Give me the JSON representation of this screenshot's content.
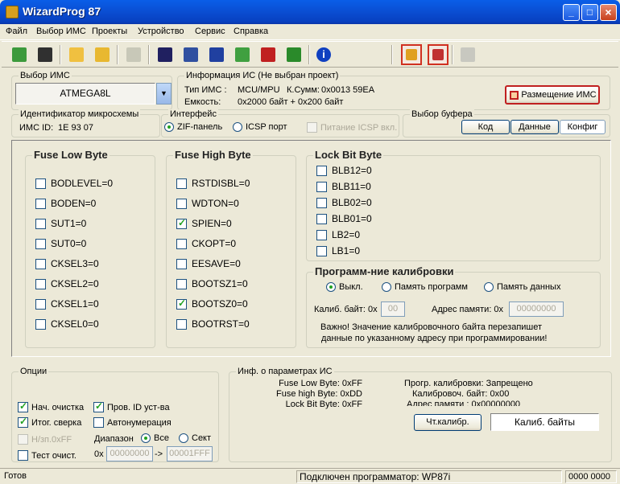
{
  "window": {
    "title": "WizardProg 87"
  },
  "menu": [
    "Файл",
    "Выбор ИМС",
    "Проекты",
    "Устройство",
    "Сервис",
    "Справка"
  ],
  "toolbar": {
    "icons": [
      "open-icon",
      "save-icon",
      "folder-icon",
      "folder-open-icon",
      "calculator-icon",
      "id-read-icon",
      "chip-read-icon",
      "chip-icon",
      "chip-write-icon",
      "chip-verify-icon",
      "chip-erase-icon",
      "info-icon",
      "chip-warning-icon",
      "eraser-icon",
      "clipboard-icon"
    ]
  },
  "chip_select": {
    "label": "Выбор ИМС",
    "value": "ATMEGA8L"
  },
  "chip_info": {
    "label": "Информация ИС (Не выбран проект)",
    "type_label": "Тип ИМС :",
    "type_value": "MCU/MPU",
    "checksum_label": "К.Сумм:",
    "checksum_value": "0x0013 59EA",
    "capacity_label": "Емкость:",
    "capacity_value": "0x2000 байт + 0x200 байт",
    "placement_button": "Размещение ИМС"
  },
  "chip_id": {
    "label": "Идентификатор микросхемы",
    "text": "ИМС ID:",
    "value": "1E 93 07"
  },
  "interface": {
    "label": "Интерфейс",
    "zif": "ZIF-панель",
    "icsp": "ICSP порт",
    "icsp_power": "Питание ICSP вкл."
  },
  "buffer": {
    "label": "Выбор буфера",
    "tabs": [
      "Код",
      "Данные",
      "Конфиг"
    ]
  },
  "fuse_low": {
    "title": "Fuse Low Byte",
    "items": [
      {
        "label": "BODLEVEL=0",
        "checked": false
      },
      {
        "label": "BODEN=0",
        "checked": false
      },
      {
        "label": "SUT1=0",
        "checked": false
      },
      {
        "label": "SUT0=0",
        "checked": false
      },
      {
        "label": "CKSEL3=0",
        "checked": false
      },
      {
        "label": "CKSEL2=0",
        "checked": false
      },
      {
        "label": "CKSEL1=0",
        "checked": false
      },
      {
        "label": "CKSEL0=0",
        "checked": false
      }
    ]
  },
  "fuse_high": {
    "title": "Fuse High Byte",
    "items": [
      {
        "label": "RSTDISBL=0",
        "checked": false
      },
      {
        "label": "WDTON=0",
        "checked": false
      },
      {
        "label": "SPIEN=0",
        "checked": true
      },
      {
        "label": "CKOPT=0",
        "checked": false
      },
      {
        "label": "EESAVE=0",
        "checked": false
      },
      {
        "label": "BOOTSZ1=0",
        "checked": false
      },
      {
        "label": "BOOTSZ0=0",
        "checked": true
      },
      {
        "label": "BOOTRST=0",
        "checked": false
      }
    ]
  },
  "lock_bits": {
    "title": "Lock Bit Byte",
    "items": [
      {
        "label": "BLB12=0",
        "checked": false
      },
      {
        "label": "BLB11=0",
        "checked": false
      },
      {
        "label": "BLB02=0",
        "checked": false
      },
      {
        "label": "BLB01=0",
        "checked": false
      },
      {
        "label": "LB2=0",
        "checked": false
      },
      {
        "label": "LB1=0",
        "checked": false
      }
    ]
  },
  "calibration": {
    "title": "Программ-ние калибровки",
    "radio_off": "Выкл.",
    "radio_program": "Память программ",
    "radio_data": "Память данных",
    "byte_label": "Калиб. байт: 0x",
    "byte_value": "00",
    "addr_label": "Адрес памяти: 0x",
    "addr_value": "00000000",
    "warning_1": "Важно! Значение калибровочного байта перезапишет",
    "warning_2": "данные по указанному адресу при программировании!"
  },
  "options": {
    "label": "Опции",
    "checkboxes": [
      {
        "label": "Нач. очистка",
        "checked": true
      },
      {
        "label": "Пров. ID уст-ва",
        "checked": true
      },
      {
        "label": "Итог. сверка",
        "checked": true
      },
      {
        "label": "Автонумерация",
        "checked": false
      },
      {
        "label": "Н/зп.0xFF",
        "checked": false
      },
      {
        "label": "Тест очист.",
        "checked": false
      }
    ],
    "range_label": "Диапазон",
    "range_all": "Все",
    "range_sect": "Сект",
    "from_prefix": "0x",
    "from_value": "00000000",
    "arrow": "->",
    "to_value": "00001FFF"
  },
  "params": {
    "label": "Инф. о параметрах ИС",
    "fuse_low": "Fuse Low Byte: 0xFF",
    "fuse_high": "Fuse high Byte: 0xDD",
    "lock_bit": "Lock Bit Byte: 0xFF",
    "prog_calib": "Прогр. калибровки: Запрещено",
    "calib_byte": "Калибровоч. байт: 0x00",
    "addr": "Адрес памяти : 0x00000000",
    "read_calib_button": "Чт.калибр.",
    "calib_bytes_field": "Калиб. байты"
  },
  "status": {
    "left": "Готов",
    "center": "Подключен программатор: WP87i",
    "right": "0000 0000"
  }
}
